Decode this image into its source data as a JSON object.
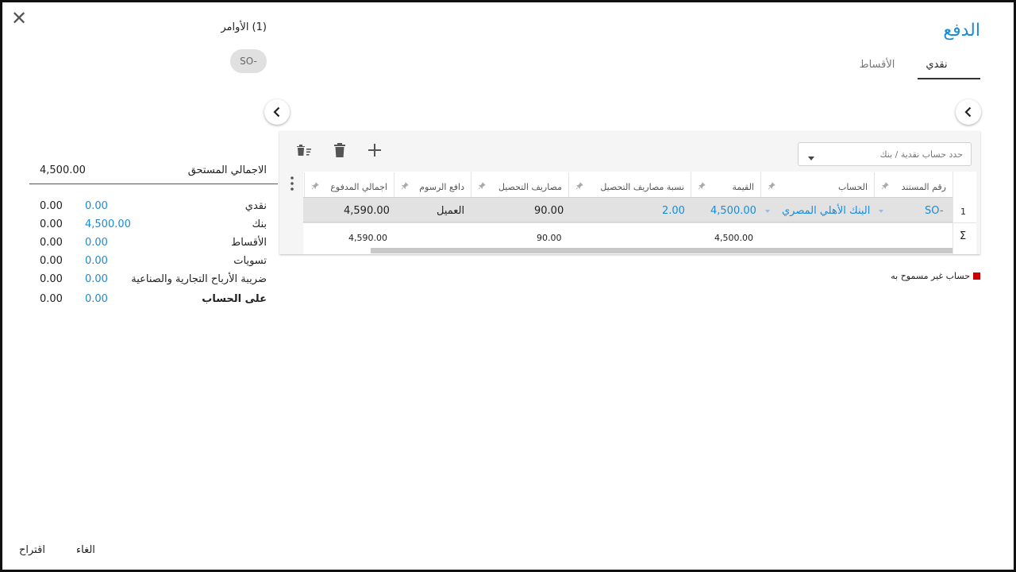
{
  "header": {
    "title": "الدفع",
    "close_icon": "close-icon",
    "tabs": [
      {
        "label": "نقدي",
        "active": true
      },
      {
        "label": "الأقساط",
        "active": false
      }
    ]
  },
  "orders": {
    "title": "(1) الأوامر",
    "chip_label": "SO-"
  },
  "summary": {
    "due_label": "الاجمالي المستحق",
    "due_value": "4,500.00",
    "rows": [
      {
        "label": "نقدي",
        "value": "0.00",
        "paid": "0.00"
      },
      {
        "label": "بنك",
        "value": "0.00",
        "paid": "4,500.00"
      },
      {
        "label": "الأقساط",
        "value": "0.00",
        "paid": "0.00"
      },
      {
        "label": "تسويات",
        "value": "0.00",
        "paid": "0.00"
      },
      {
        "label": "ضريبة الأرباح التجارية والصناعية",
        "value": "0.00",
        "paid": "0.00"
      },
      {
        "label": "على الحساب",
        "value": "0.00",
        "paid": "0.00"
      }
    ]
  },
  "toolbar": {
    "account_select_placeholder": "حدد حساب نقدية / بنك",
    "add_icon": "plus-icon",
    "delete_icon": "trash-icon",
    "clear_icon": "delete-sweep-icon"
  },
  "grid": {
    "columns": [
      "رقم المستند",
      "الحساب",
      "القيمة",
      "نسبة مصاريف التحصيل",
      "مصاريف التحصيل",
      "دافع الرسوم",
      "اجمالي المدفوع"
    ],
    "rows": [
      {
        "row_number": "1",
        "doc_no": "SO-",
        "account": "البنك الأهلي المصري",
        "amount": "4,500.00",
        "fee_rate": "2.00",
        "fee": "90.00",
        "fee_payer": "العميل",
        "total_paid": "4,590.00"
      }
    ],
    "totals": {
      "symbol": "Σ",
      "amount": "4,500.00",
      "fee": "90.00",
      "total_paid": "4,590.00"
    }
  },
  "legend": {
    "label": "حساب غير مسموح به",
    "color": "#cc0000"
  },
  "footer": {
    "cancel_label": "الغاء",
    "suggest_label": "اقتراح"
  },
  "colors": {
    "accent": "#1a8bd6"
  }
}
